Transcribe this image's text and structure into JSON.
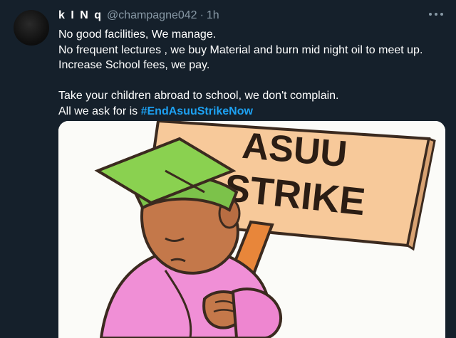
{
  "tweet": {
    "display_name": "k I N q",
    "handle": "@champagne042",
    "separator": "·",
    "time": "1h",
    "lines": [
      "No good facilities, We manage.",
      "No frequent lectures , we buy Material and burn mid night oil to meet up.",
      "Increase School fees, we pay.",
      "",
      "Take your children abroad to school, we don't complain."
    ],
    "last_line_prefix": "All we ask for is ",
    "hashtag": "#EndAsuuStrikeNow",
    "media": {
      "sign_line1": "ASUU",
      "sign_line2": "STRIKE"
    }
  },
  "colors": {
    "background": "#15202b",
    "text": "#ffffff",
    "secondary": "#8899a6",
    "link": "#1da1f2"
  },
  "icons": [
    "avatar",
    "more-options-icon"
  ]
}
